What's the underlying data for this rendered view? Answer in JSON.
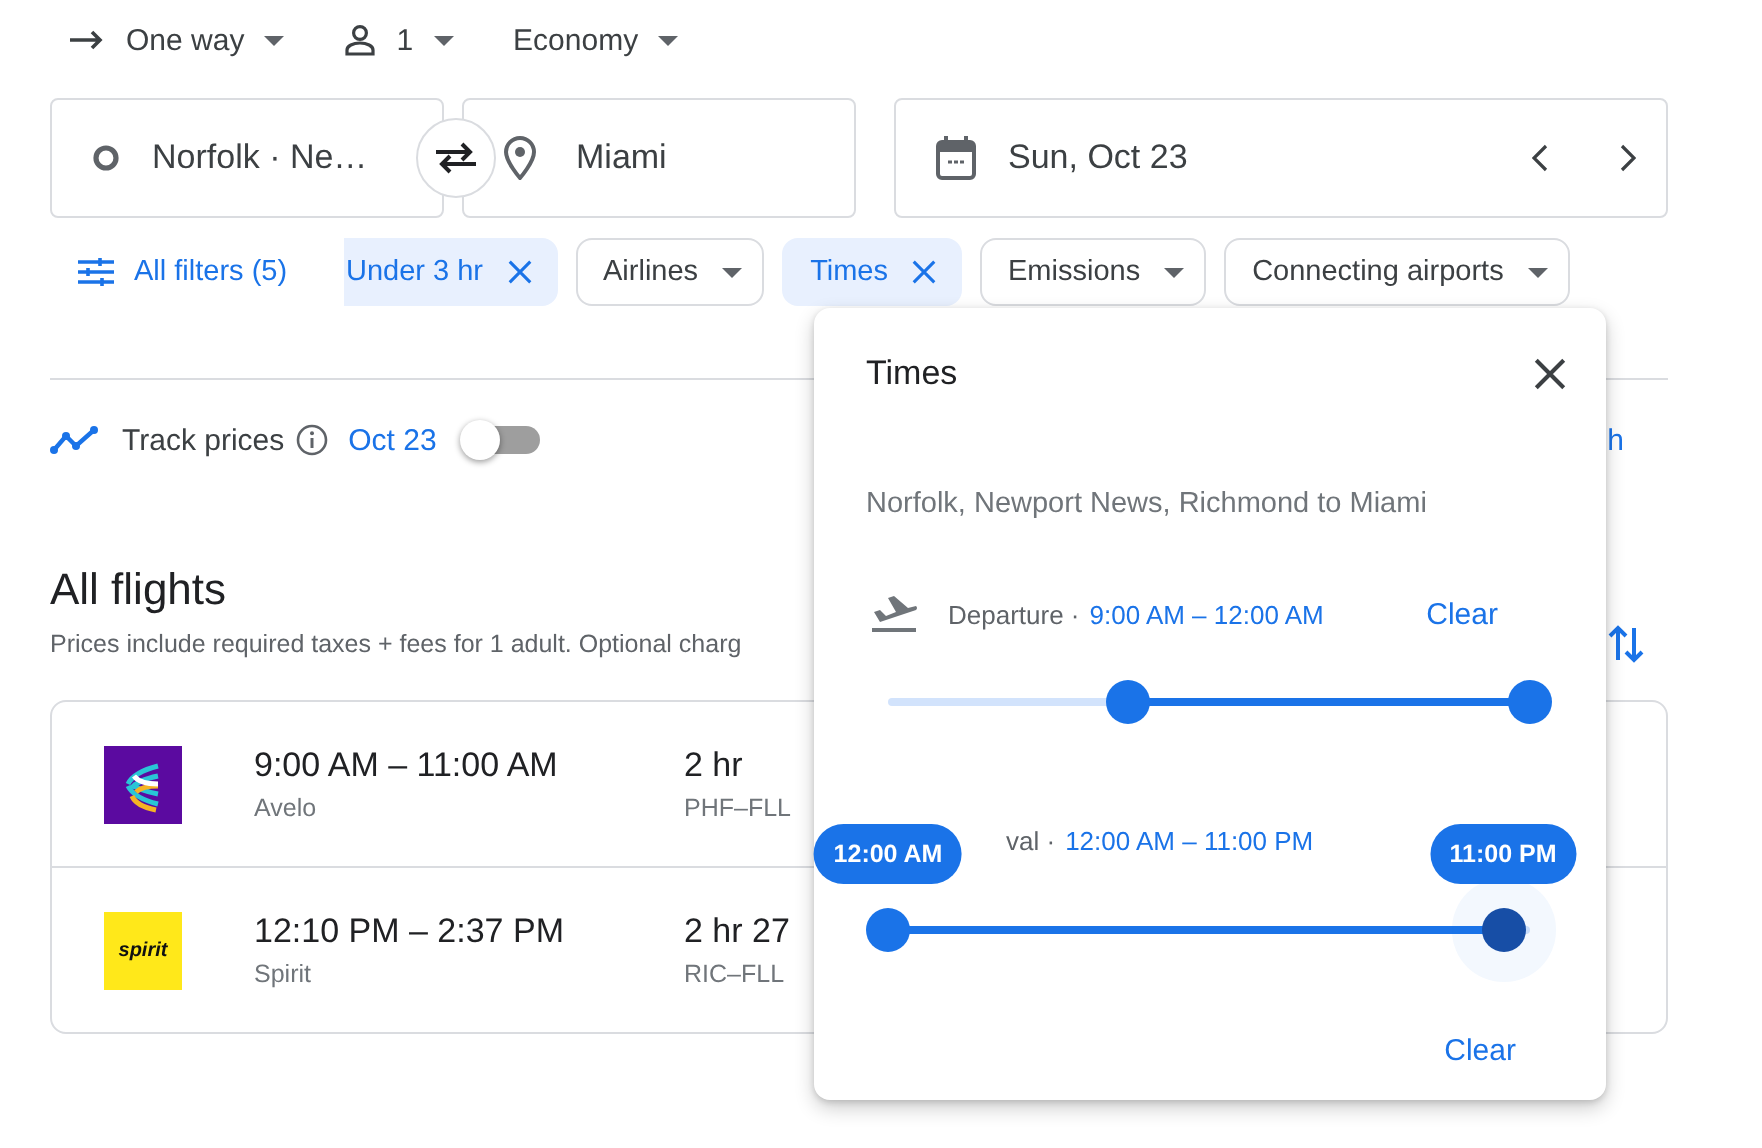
{
  "trip_bar": [
    {
      "kind": "trip",
      "label": "One way"
    },
    {
      "kind": "passengers",
      "label": "1"
    },
    {
      "kind": "class",
      "label": "Economy"
    }
  ],
  "search": {
    "origin": "Norfolk · Ne…",
    "destination": "Miami",
    "date": "Sun, Oct 23"
  },
  "filters": {
    "all_label": "All filters (5)",
    "chips": [
      {
        "label": "Under 3 hr",
        "selected": true
      },
      {
        "label": "Airlines",
        "selected": false
      },
      {
        "label": "Times",
        "selected": true
      },
      {
        "label": "Emissions",
        "selected": false
      },
      {
        "label": "Connecting airports",
        "selected": false
      }
    ]
  },
  "track": {
    "label": "Track prices",
    "date": "Oct 23",
    "on": false,
    "side_link": "h"
  },
  "results": {
    "title": "All flights",
    "note": "Prices include required taxes + fees for 1 adult. Optional charg",
    "flights": [
      {
        "kind": "avelo",
        "times": "9:00 AM – 11:00 AM",
        "airline": "Avelo",
        "duration": "2 hr",
        "route": "PHF–FLL"
      },
      {
        "kind": "spirit",
        "logo_text": "spirit",
        "times": "12:10 PM – 2:37 PM",
        "airline": "Spirit",
        "duration": "2 hr 27",
        "route": "RIC–FLL"
      }
    ]
  },
  "popup": {
    "title": "Times",
    "route": "Norfolk, Newport News, Richmond to Miami",
    "ranges": [
      {
        "kind": "departure",
        "label": "Departure ·",
        "value": "9:00 AM – 12:00 AM",
        "clear": "Clear",
        "thumbs": [
          {
            "level": 0.375,
            "focused": false
          },
          {
            "level": 1,
            "focused": false
          }
        ]
      },
      {
        "kind": "arrival",
        "label": "val ·",
        "value": "12:00 AM – 11:00 PM",
        "thumbs": [
          {
            "level": 0,
            "focused": false,
            "tooltip": "12:00 AM"
          },
          {
            "level": 0.958,
            "focused": true,
            "tooltip": "11:00 PM"
          }
        ]
      }
    ],
    "clear": "Clear"
  }
}
